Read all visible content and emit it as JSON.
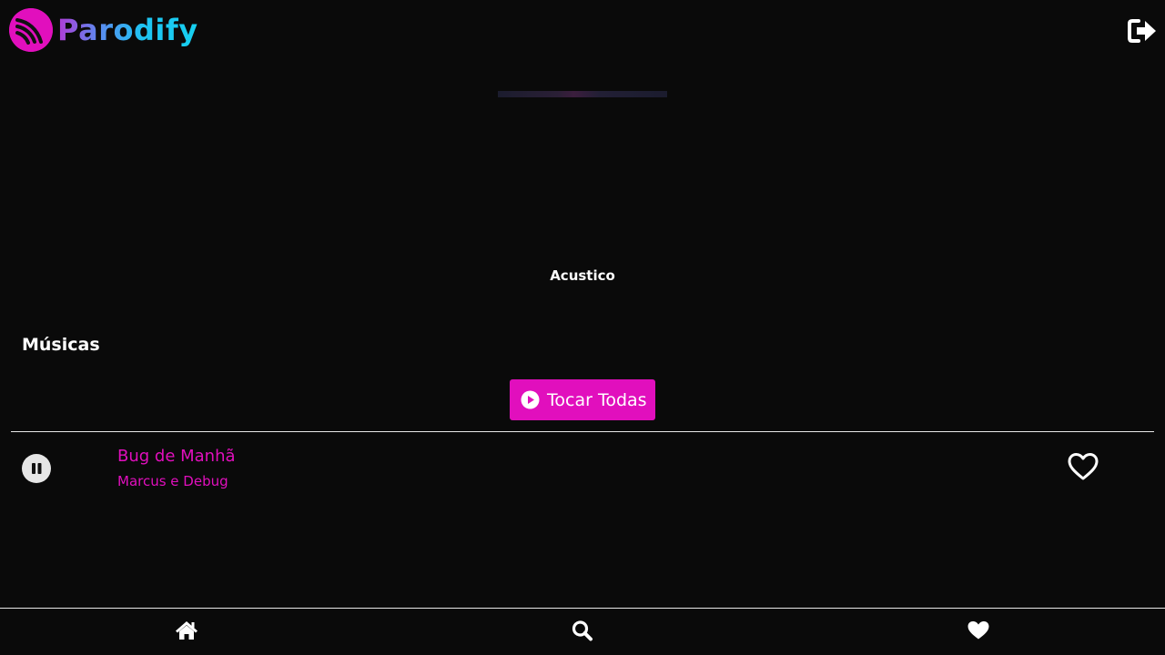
{
  "app": {
    "name": "Parodify",
    "logo_icon": "parodify-logo-icon",
    "logout_icon": "sign-out-icon"
  },
  "playlist": {
    "title": "Acustico"
  },
  "tracks_section": {
    "title": "Músicas",
    "play_all_label": "Tocar Todas",
    "play_all_icon": "play-circle-icon"
  },
  "tracks": [
    {
      "title": "Bug de Manhã",
      "artist": "Marcus e Debug",
      "state_icon": "pause-icon",
      "like_icon": "heart-outline-icon"
    }
  ],
  "bottom_nav": {
    "items": [
      {
        "icon": "home-icon"
      },
      {
        "icon": "search-icon"
      },
      {
        "icon": "heart-icon"
      }
    ]
  },
  "colors": {
    "background": "#0a0a0a",
    "accent": "#e10fbd",
    "text": "#ffffff",
    "divider": "#e8e8e8"
  }
}
